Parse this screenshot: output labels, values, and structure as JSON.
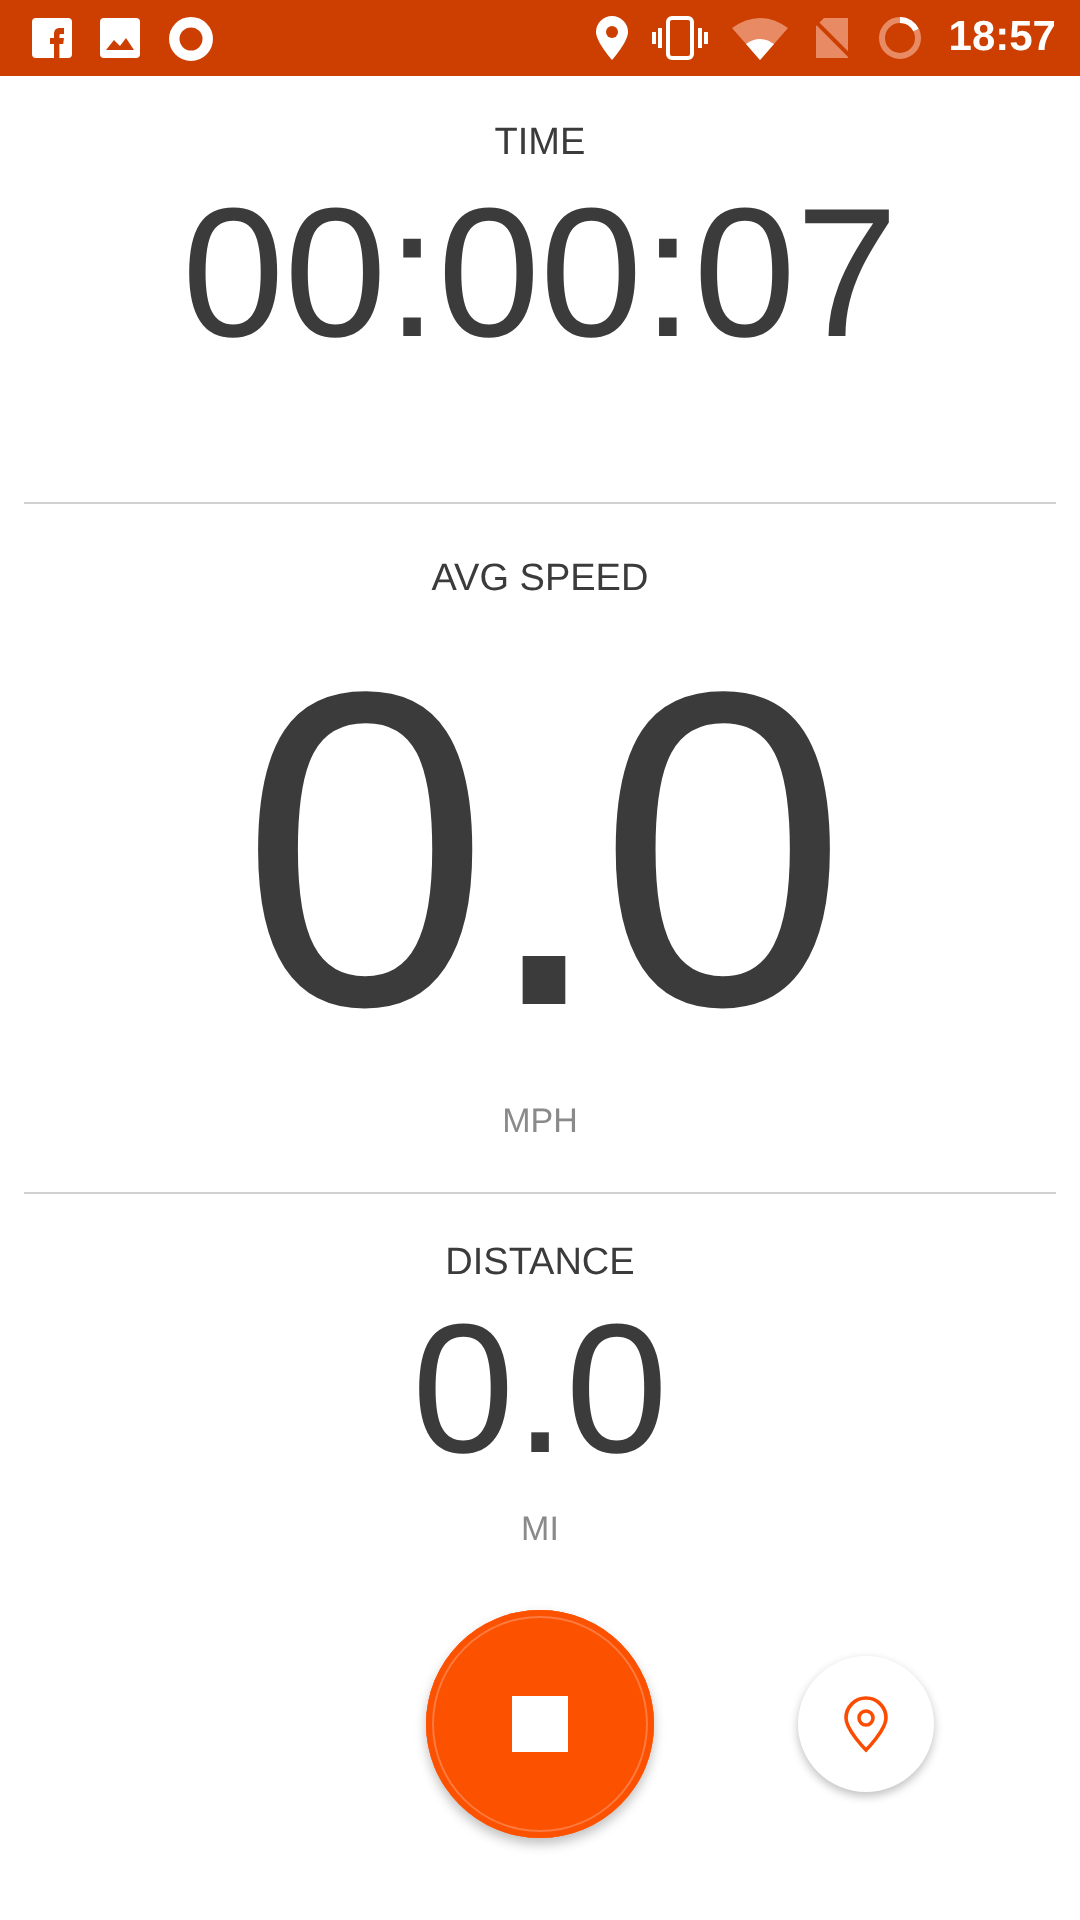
{
  "status_bar": {
    "time": "18:57"
  },
  "metrics": [
    {
      "kind": "time",
      "label": "TIME",
      "value": "00:00:07"
    },
    {
      "kind": "primary",
      "label": "AVG SPEED",
      "value": "0.0",
      "unit": "MPH"
    },
    {
      "kind": "secondary",
      "label": "DISTANCE",
      "value": "0.0",
      "unit": "MI"
    }
  ]
}
